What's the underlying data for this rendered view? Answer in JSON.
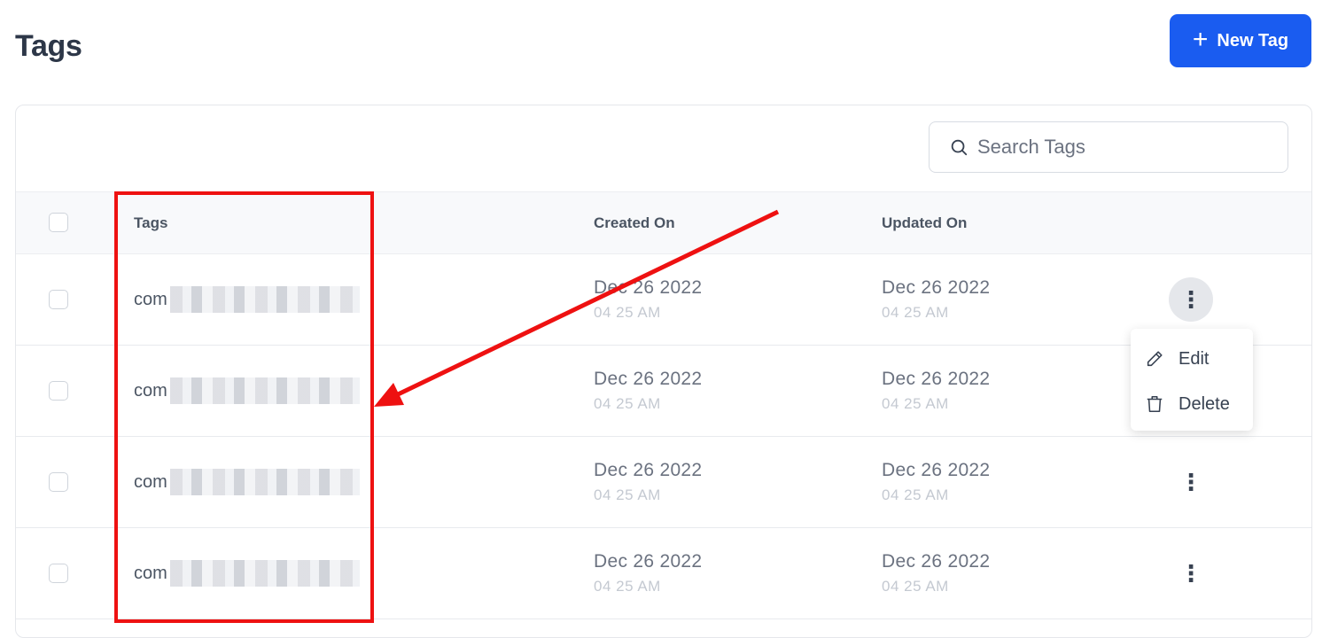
{
  "header": {
    "title": "Tags",
    "new_tag_label": "New Tag"
  },
  "search": {
    "placeholder": "Search Tags",
    "value": ""
  },
  "table": {
    "columns": [
      "Tags",
      "Created On",
      "Updated On"
    ],
    "rows": [
      {
        "tag_prefix": "com",
        "created_date": "Dec 26 2022",
        "created_time": "04 25 AM",
        "updated_date": "Dec 26 2022",
        "updated_time": "04 25 AM"
      },
      {
        "tag_prefix": "com",
        "created_date": "Dec 26 2022",
        "created_time": "04 25 AM",
        "updated_date": "Dec 26 2022",
        "updated_time": "04 25 AM"
      },
      {
        "tag_prefix": "com",
        "created_date": "Dec 26 2022",
        "created_time": "04 25 AM",
        "updated_date": "Dec 26 2022",
        "updated_time": "04 25 AM"
      },
      {
        "tag_prefix": "com",
        "created_date": "Dec 26 2022",
        "created_time": "04 25 AM",
        "updated_date": "Dec 26 2022",
        "updated_time": "04 25 AM"
      }
    ]
  },
  "row_menu": {
    "items": [
      "Edit",
      "Delete"
    ]
  },
  "colors": {
    "primary": "#1a5cf0",
    "annotation": "#ee1111"
  },
  "icons": [
    "plus-icon",
    "search-icon",
    "more-vertical-icon",
    "pencil-icon",
    "trash-icon"
  ]
}
